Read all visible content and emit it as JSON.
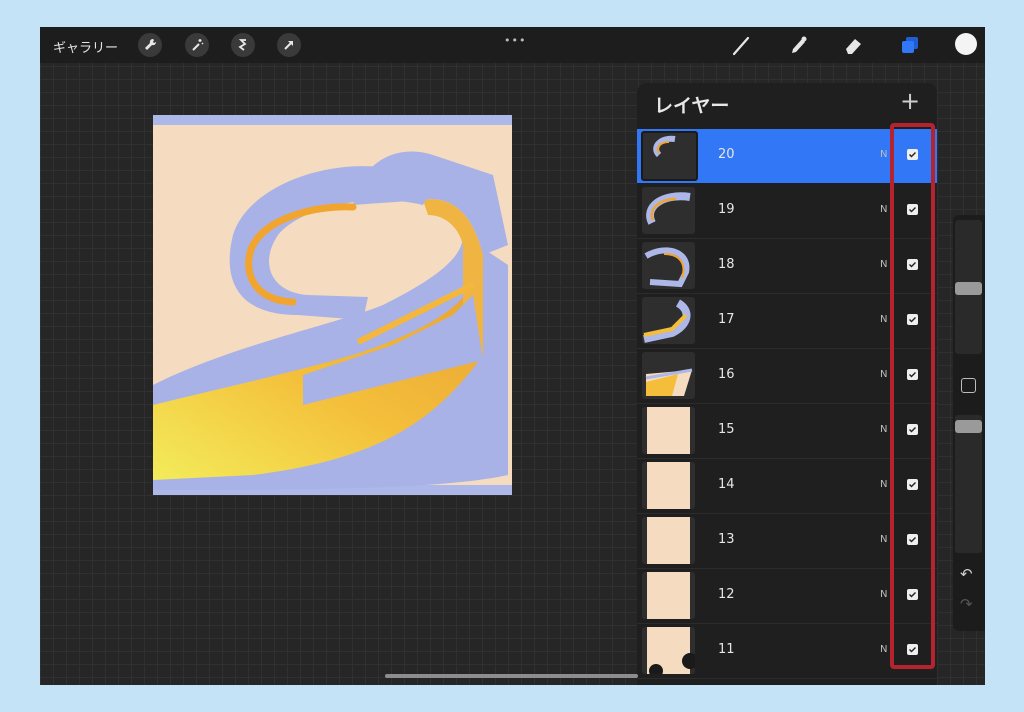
{
  "app": {
    "gallery_label": "ギャラリー",
    "more_label": "•••"
  },
  "toolbar": {
    "left_tools": [
      "wrench-icon",
      "magic-wand-icon",
      "selection-icon",
      "transform-arrow-icon"
    ],
    "right_tools": [
      "brush-icon",
      "smudge-icon",
      "eraser-icon",
      "layers-icon"
    ],
    "color": "#f4f4f4",
    "active_color": "#3277f5"
  },
  "layers_panel": {
    "title": "レイヤー",
    "add_label": "+",
    "layers": [
      {
        "name": "20",
        "blend": "N",
        "visible": true,
        "selected": true
      },
      {
        "name": "19",
        "blend": "N",
        "visible": true
      },
      {
        "name": "18",
        "blend": "N",
        "visible": true
      },
      {
        "name": "17",
        "blend": "N",
        "visible": true
      },
      {
        "name": "16",
        "blend": "N",
        "visible": true
      },
      {
        "name": "15",
        "blend": "N",
        "visible": true
      },
      {
        "name": "14",
        "blend": "N",
        "visible": true
      },
      {
        "name": "13",
        "blend": "N",
        "visible": true
      },
      {
        "name": "12",
        "blend": "N",
        "visible": true
      },
      {
        "name": "11",
        "blend": "N",
        "visible": true
      }
    ]
  },
  "annotation": {
    "color": "#b5232f"
  },
  "sidebar": {
    "undo_label": "↶",
    "redo_label": "↷"
  }
}
